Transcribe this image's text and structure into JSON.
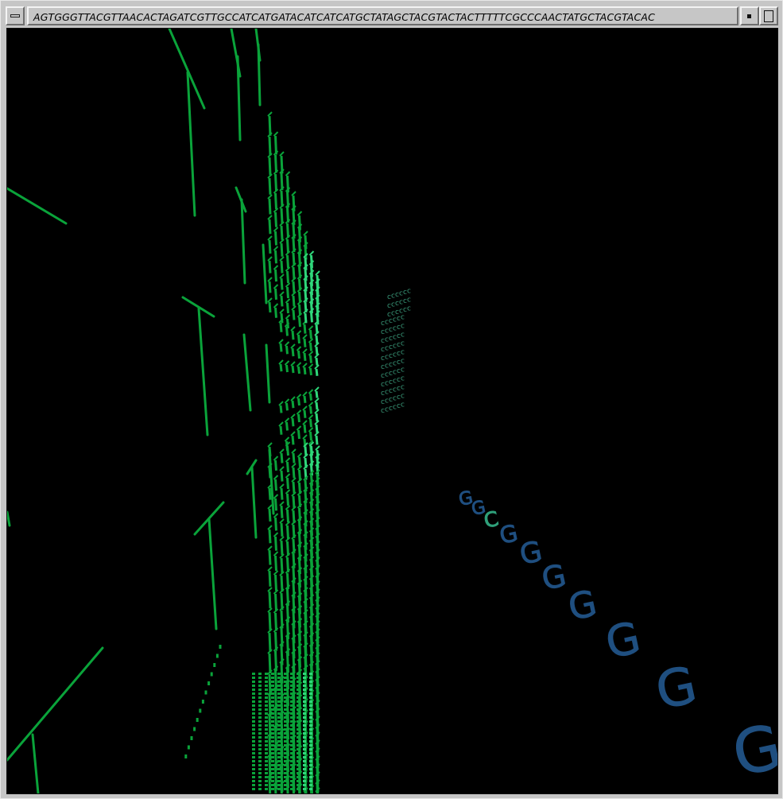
{
  "window": {
    "title": "AGTGGGTTACGTTAACACTAGATCGTTGCCATCATGATACATCATCATGCTATAGCTACGTACTACTTTTTCGCCCAACTATGCTACGTACAC",
    "buttons": {
      "menu": "window-menu",
      "minimize": "minimize",
      "maximize": "maximize"
    }
  },
  "scene": {
    "background": "#000000",
    "colors": {
      "green": "#0aa33a",
      "light_green": "#2fd67a",
      "teal": "#3a9a7a",
      "blue": "#1f4f80"
    },
    "letters": [
      "G",
      "G",
      "C",
      "G",
      "G",
      "G",
      "G",
      "G",
      "G",
      "G"
    ],
    "letter_colors": [
      "#1f4f80",
      "#1f4f80",
      "#2fa07a",
      "#1f4f80",
      "#1f4f80",
      "#1f4f80",
      "#1f4f80",
      "#1f4f80",
      "#1f4f80",
      "#1f4f80"
    ]
  }
}
